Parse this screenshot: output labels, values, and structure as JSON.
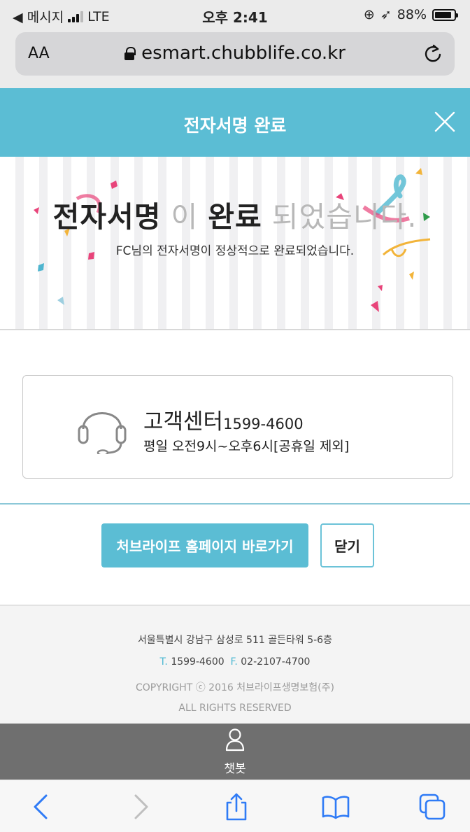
{
  "status_bar": {
    "back_app": "◀ 메시지",
    "network": "LTE",
    "time": "오후 2:41",
    "battery": "88%",
    "battery_level": 0.88
  },
  "browser": {
    "text_size": "AA",
    "url": "esmart.chubblife.co.kr"
  },
  "header": {
    "title": "전자서명 완료"
  },
  "banner": {
    "head_1": "전자서명",
    "head_2": " 이 ",
    "head_3": "완료",
    "head_4": " 되었습니다.",
    "sub": "FC님의 전자서명이 정상적으로 완료되었습니다."
  },
  "customer_center": {
    "title": "고객센터",
    "phone": "1599-4600",
    "hours": "평일 오전9시~오후6시[공휴일 제외]"
  },
  "buttons": {
    "homepage": "처브라이프 홈페이지 바로가기",
    "close": "닫기"
  },
  "footer": {
    "address": "서울특별시 강남구 삼성로 511 골든타워 5-6층",
    "tel_label": "T.",
    "tel": "1599-4600",
    "fax_label": "F.",
    "fax": "02-2107-4700",
    "copyright": "COPYRIGHT ⓒ 2016 처브라이프생명보험(주)",
    "rights": "ALL RIGHTS RESERVED"
  },
  "chatbot": {
    "label": "챗봇"
  },
  "colors": {
    "accent": "#5bbdd4",
    "chatbot_bar": "#6f6f6f",
    "toolbar_icon": "#2f7bf6",
    "toolbar_icon_disabled": "#bfbfbf"
  }
}
